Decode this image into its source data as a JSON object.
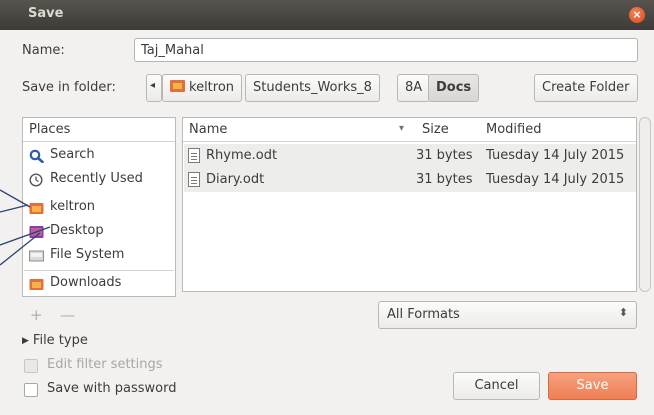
{
  "window": {
    "title": "Save",
    "close_glyph": "×"
  },
  "name_field": {
    "label": "Name:",
    "value": "Taj_Mahal"
  },
  "save_in": {
    "label": "Save in folder:",
    "back_glyph": "◂",
    "path": [
      "keltron",
      "Students_Works_8",
      "8A",
      "Docs"
    ],
    "create_folder_label": "Create Folder"
  },
  "places": {
    "header": "Places",
    "items": [
      "Search",
      "Recently Used",
      "keltron",
      "Desktop",
      "File System",
      "Downloads"
    ],
    "add_glyph": "+",
    "remove_glyph": "—"
  },
  "file_list": {
    "columns": {
      "name": "Name",
      "size": "Size",
      "modified": "Modified"
    },
    "sort_glyph": "▾",
    "rows": [
      {
        "name": "Rhyme.odt",
        "size": "31 bytes",
        "modified": "Tuesday 14 July 2015"
      },
      {
        "name": "Diary.odt",
        "size": "31 bytes",
        "modified": "Tuesday 14 July 2015"
      }
    ]
  },
  "filter": {
    "value": "All Formats",
    "arrow_glyph": "⬍"
  },
  "options": {
    "file_type_label": "File type",
    "expander_glyph": "▶",
    "edit_filter_label": "Edit filter settings",
    "save_password_label": "Save with password"
  },
  "buttons": {
    "cancel": "Cancel",
    "save": "Save"
  },
  "colors": {
    "accent": "#ee7f55",
    "titlebar": "#3d3b37",
    "annotation_line": "#2b4470"
  }
}
